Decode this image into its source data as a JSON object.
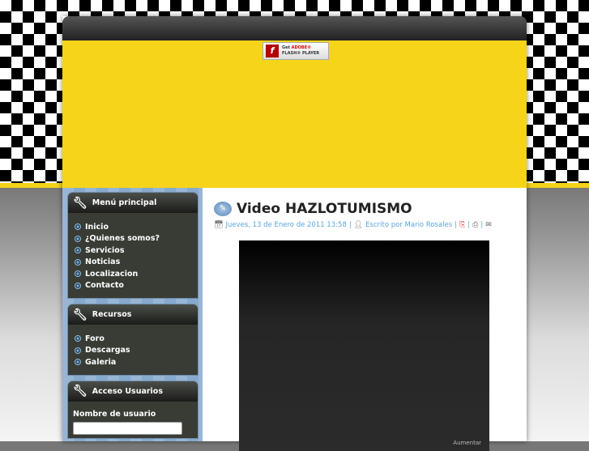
{
  "banner": {
    "flash_get": "Get",
    "flash_adobe": "ADOBE®",
    "flash_player": "FLASH® PLAYER"
  },
  "sidebar": {
    "menu": {
      "title": "Menú principal",
      "items": [
        "Inicio",
        "¿Quienes somos?",
        "Servicios",
        "Noticias",
        "Localizacion",
        "Contacto"
      ]
    },
    "resources": {
      "title": "Recursos",
      "items": [
        "Foro",
        "Descargas",
        "Galeria"
      ]
    },
    "login": {
      "title": "Acceso Usuarios",
      "username_label": "Nombre de usuario",
      "username_value": ""
    }
  },
  "article": {
    "title": "Video HAZLOTUMISMO",
    "date": "Jueves, 13 de Enero de 2011 13:58",
    "author": "Escrito por Mario Rosales",
    "sep": "|"
  },
  "video": {
    "zoom_label": "Aumentar"
  }
}
